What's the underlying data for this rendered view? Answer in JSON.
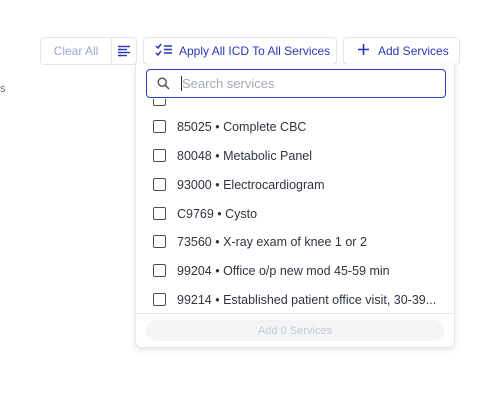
{
  "page": {
    "edge_glyph": "s"
  },
  "toolbar": {
    "clear_all_label": "Clear All",
    "apply_icd_label": "Apply All ICD To All Services",
    "add_services_label": "Add Services"
  },
  "search": {
    "placeholder": "Search services",
    "value": ""
  },
  "services": [
    {
      "code": "",
      "label": ""
    },
    {
      "code": "85025",
      "label": "85025 • Complete CBC"
    },
    {
      "code": "80048",
      "label": "80048 • Metabolic Panel"
    },
    {
      "code": "93000",
      "label": "93000 • Electrocardiogram"
    },
    {
      "code": "C9769",
      "label": "C9769 • Cysto"
    },
    {
      "code": "73560",
      "label": "73560 • X-ray exam of knee 1 or 2"
    },
    {
      "code": "99204",
      "label": "99204 • Office o/p new mod 45-59 min"
    },
    {
      "code": "99214",
      "label": "99214 • Established patient office visit, 30-39..."
    }
  ],
  "footer": {
    "add_selected_label": "Add 0 Services"
  },
  "colors": {
    "accent": "#2838b9",
    "focus_border": "#3340b8",
    "muted": "#9aa6d6"
  },
  "icons": {
    "filter": "filter-lines-icon",
    "apply_icd": "checklist-icon",
    "add": "plus-icon",
    "search": "magnifier-icon"
  }
}
